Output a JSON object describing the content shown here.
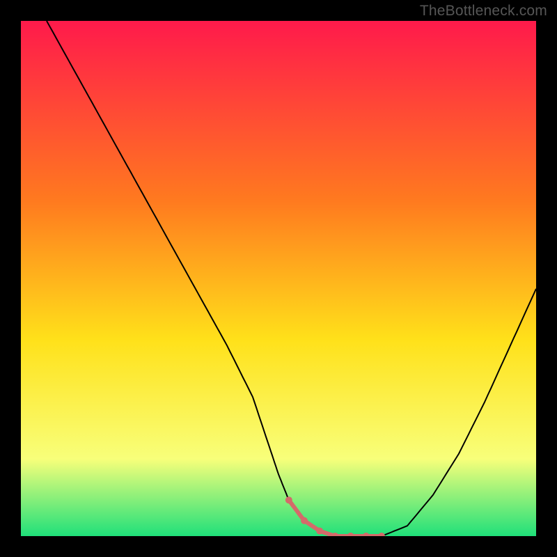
{
  "watermark": "TheBottleneck.com",
  "colors": {
    "gradient_top": "#ff1a4b",
    "gradient_mid_upper": "#ff7a1f",
    "gradient_mid": "#ffe11a",
    "gradient_lower": "#f8ff7a",
    "gradient_bottom": "#1fe07a",
    "curve": "#000000",
    "marker": "#d46a6a",
    "frame": "#000000"
  },
  "chart_data": {
    "type": "line",
    "title": "",
    "xlabel": "",
    "ylabel": "",
    "xlim": [
      0,
      100
    ],
    "ylim": [
      0,
      100
    ],
    "series": [
      {
        "name": "bottleneck-curve",
        "x": [
          5,
          10,
          15,
          20,
          25,
          30,
          35,
          40,
          45,
          48,
          50,
          52,
          55,
          58,
          61,
          64,
          70,
          75,
          80,
          85,
          90,
          95,
          100
        ],
        "values": [
          100,
          91,
          82,
          73,
          64,
          55,
          46,
          37,
          27,
          18,
          12,
          7,
          3,
          1,
          0,
          0,
          0,
          2,
          8,
          16,
          26,
          37,
          48
        ]
      }
    ],
    "highlight_range_x": [
      52,
      70
    ],
    "highlight_markers_x": [
      52,
      55,
      58,
      61,
      64,
      67,
      70
    ]
  }
}
